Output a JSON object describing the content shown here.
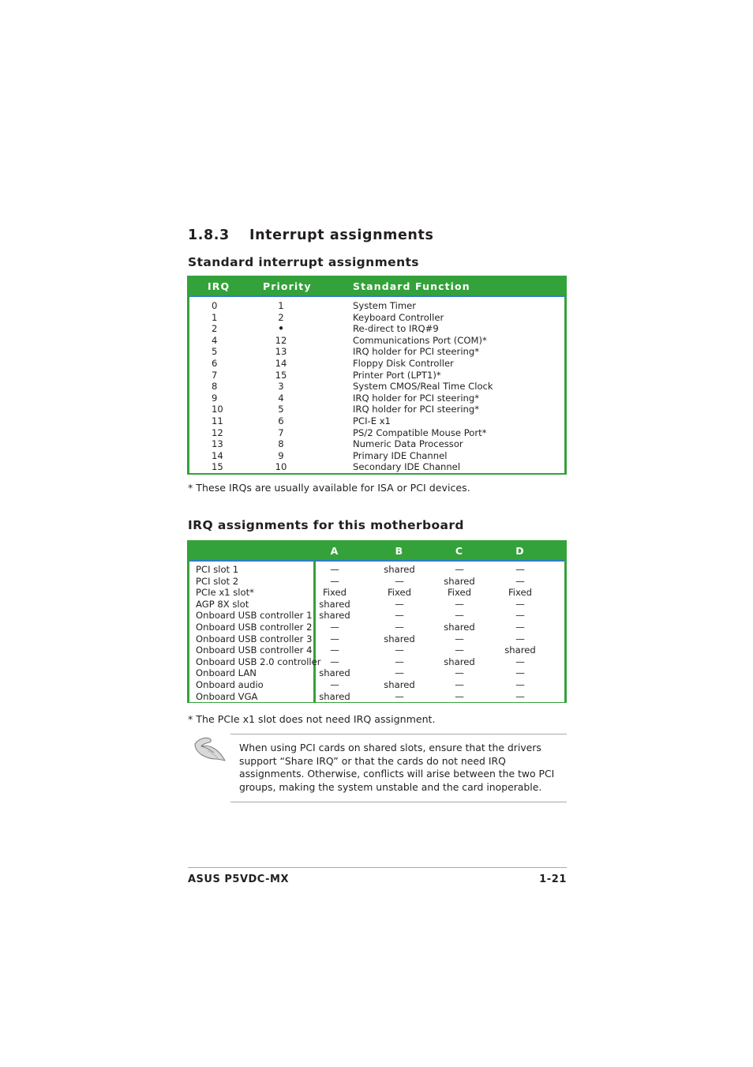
{
  "section": {
    "number": "1.8.3",
    "title": "Interrupt assignments"
  },
  "standard_table": {
    "heading": "Standard interrupt assignments",
    "columns": [
      "IRQ",
      "Priority",
      "Standard Function"
    ],
    "rows": [
      {
        "irq": "0",
        "priority": "1",
        "function": "System Timer"
      },
      {
        "irq": "1",
        "priority": "2",
        "function": "Keyboard Controller"
      },
      {
        "irq": "2",
        "priority": "•",
        "function": "Re-direct to IRQ#9"
      },
      {
        "irq": "4",
        "priority": "12",
        "function": "Communications Port (COM)*"
      },
      {
        "irq": "5",
        "priority": "13",
        "function": "IRQ holder for PCI steering*"
      },
      {
        "irq": "6",
        "priority": "14",
        "function": "Floppy Disk Controller"
      },
      {
        "irq": "7",
        "priority": "15",
        "function": "Printer Port (LPT1)*"
      },
      {
        "irq": "8",
        "priority": "3",
        "function": "System CMOS/Real Time Clock"
      },
      {
        "irq": "9",
        "priority": "4",
        "function": "IRQ holder for PCI steering*"
      },
      {
        "irq": "10",
        "priority": "5",
        "function": "IRQ holder for PCI steering*"
      },
      {
        "irq": "11",
        "priority": "6",
        "function": "PCI-E x1"
      },
      {
        "irq": "12",
        "priority": "7",
        "function": "PS/2 Compatible Mouse Port*"
      },
      {
        "irq": "13",
        "priority": "8",
        "function": "Numeric Data Processor"
      },
      {
        "irq": "14",
        "priority": "9",
        "function": "Primary IDE Channel"
      },
      {
        "irq": "15",
        "priority": "10",
        "function": "Secondary IDE Channel"
      }
    ],
    "footnote": "* These IRQs are usually available for ISA or PCI devices."
  },
  "board_table": {
    "heading": "IRQ assignments for this motherboard",
    "columns": [
      "",
      "A",
      "B",
      "C",
      "D"
    ],
    "rows": [
      {
        "name": "PCI slot 1",
        "a": "—",
        "b": "shared",
        "c": "—",
        "d": "—"
      },
      {
        "name": "PCI slot 2",
        "a": "—",
        "b": "—",
        "c": "shared",
        "d": "—"
      },
      {
        "name": "PCIe x1 slot*",
        "a": "Fixed",
        "b": "Fixed",
        "c": "Fixed",
        "d": "Fixed"
      },
      {
        "name": "AGP 8X slot",
        "a": "shared",
        "b": "—",
        "c": "—",
        "d": "—"
      },
      {
        "name": "Onboard USB controller 1",
        "a": "shared",
        "b": "—",
        "c": "—",
        "d": "—"
      },
      {
        "name": "Onboard USB controller 2",
        "a": "—",
        "b": "—",
        "c": "shared",
        "d": "—"
      },
      {
        "name": "Onboard USB controller 3",
        "a": "—",
        "b": "shared",
        "c": "—",
        "d": "—"
      },
      {
        "name": "Onboard USB controller 4",
        "a": "—",
        "b": "—",
        "c": "—",
        "d": "shared"
      },
      {
        "name": "Onboard USB 2.0 controller",
        "a": "—",
        "b": "—",
        "c": "shared",
        "d": "—"
      },
      {
        "name": "Onboard LAN",
        "a": "shared",
        "b": "—",
        "c": "—",
        "d": "—"
      },
      {
        "name": "Onboard audio",
        "a": "—",
        "b": "shared",
        "c": "—",
        "d": "—"
      },
      {
        "name": "Onboard VGA",
        "a": "shared",
        "b": "—",
        "c": "—",
        "d": "—"
      }
    ],
    "footnote": "* The PCIe x1 slot does not need IRQ assignment."
  },
  "note": {
    "icon": "pointing-hand-icon",
    "text": "When using PCI cards on shared slots, ensure that the drivers support “Share IRQ” or that the cards do not need IRQ assignments. Otherwise, conflicts will arise between the two PCI groups, making the system unstable and the card inoperable."
  },
  "footer": {
    "product": "ASUS P5VDC-MX",
    "page_number": "1-21"
  },
  "colors": {
    "table_green": "#34a23a",
    "header_rule_blue": "#2f7dc4",
    "text": "#231f20",
    "rule_gray": "#a7a9ac"
  }
}
